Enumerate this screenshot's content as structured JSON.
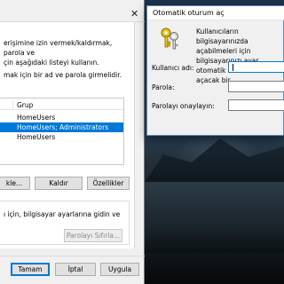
{
  "left_dialog": {
    "close_glyph": "✕",
    "description": "erişimine izin vermek/kaldırmak, parola ve\nçin aşağıdaki listeyi kullanın.",
    "must_enter": "mak için bir ad ve parola girmelidir.",
    "table": {
      "column_group": "Grup",
      "rows": [
        {
          "group": "HomeUsers",
          "selected": false
        },
        {
          "group": "HomeUsers; Administrators",
          "selected": true
        },
        {
          "group": "HomeUsers",
          "selected": false
        }
      ]
    },
    "buttons": {
      "add": "kle...",
      "remove": "Kaldır",
      "properties": "Özellikler"
    },
    "password_group": {
      "text": "ı için, bilgisayar ayarlarına gidin ve",
      "reset_button": "Parolayı Sıfırla..."
    },
    "footer": {
      "ok": "Tamam",
      "cancel": "İptal",
      "apply": "Uygula"
    }
  },
  "right_dialog": {
    "title": "Otomatik oturum aç",
    "icon": "keys-icon",
    "info": "Kullanıcıların bilgisayarınızda\naçabilmeleri için bilgisayarınızı ayar\notomatik olarak oturum açacak bir",
    "fields": {
      "username_label": "Kullanıcı adı:",
      "password_label": "Parola:",
      "confirm_label": "Parolayı onaylayın:"
    }
  },
  "colors": {
    "accent": "#0078d7",
    "dialog_bg": "#f0f0f0"
  }
}
